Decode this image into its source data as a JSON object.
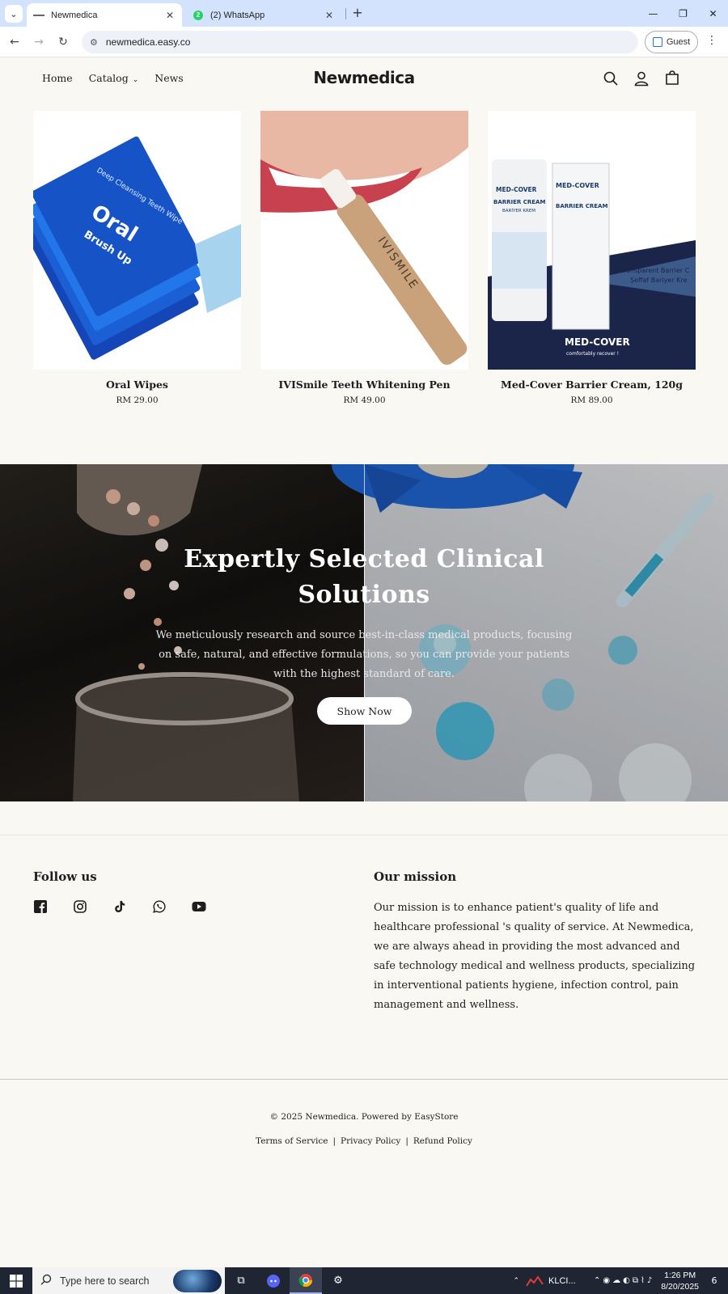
{
  "browser": {
    "tabs": [
      {
        "title": "Newmedica",
        "active": true
      },
      {
        "title": "(2) WhatsApp",
        "active": false,
        "badge": "2"
      }
    ],
    "url": "newmedica.easy.co",
    "profile_label": "Guest"
  },
  "header": {
    "nav": [
      {
        "label": "Home"
      },
      {
        "label": "Catalog"
      },
      {
        "label": "News"
      }
    ],
    "logo": "Newmedica",
    "icons": [
      "search-icon",
      "account-icon",
      "cart-icon"
    ]
  },
  "products": [
    {
      "name": "Oral Wipes",
      "price": "RM 29.00",
      "image_text": [
        "Oral",
        "Brush Up",
        "Deep Cleansing Teeth Wipe"
      ]
    },
    {
      "name": "IVISmile Teeth Whitening Pen",
      "price": "RM 49.00",
      "image_text": [
        "IVISMILE"
      ]
    },
    {
      "name": "Med-Cover Barrier Cream, 120g",
      "price": "RM 89.00",
      "image_text": [
        "MED-COVER",
        "BARRIER CREAM",
        "BARİYER KREM",
        "Transparent Barrier C",
        "Şeffaf Bariyer Kre",
        "comfortably recover !"
      ]
    }
  ],
  "banner": {
    "title": "Expertly Selected Clinical Solutions",
    "text": "We meticulously research and source best-in-class medical products, focusing on safe, natural, and effective formulations, so you can provide your patients with the highest standard of care.",
    "button_label": "Show Now"
  },
  "footer": {
    "follow_title": "Follow us",
    "socials": [
      "facebook-icon",
      "instagram-icon",
      "tiktok-icon",
      "whatsapp-icon",
      "youtube-icon"
    ],
    "mission_title": "Our mission",
    "mission_text": "Our mission is to enhance patient's quality of life and healthcare professional 's quality of service. At Newmedica, we are always ahead in providing the most advanced and safe technology medical and wellness products, specializing in interventional patients hygiene, infection control, pain management and wellness.",
    "copyright": "© 2025 Newmedica. Powered by EasyStore",
    "policies": [
      {
        "label": "Terms of Service"
      },
      {
        "label": "Privacy Policy"
      },
      {
        "label": "Refund Policy"
      }
    ],
    "policy_separator": "|"
  },
  "taskbar": {
    "search_placeholder": "Type here to search",
    "stock_label": "KLCI...",
    "time": "1:26 PM",
    "date": "8/20/2025",
    "notification_count": "6"
  }
}
